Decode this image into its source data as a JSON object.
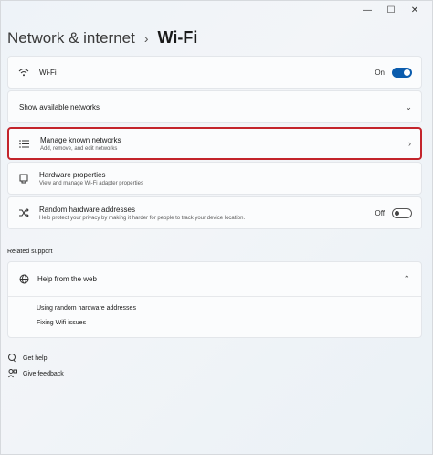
{
  "window": {
    "minimize": "—",
    "maximize": "☐",
    "close": "✕"
  },
  "breadcrumb": {
    "parent": "Network & internet",
    "separator": "›",
    "current": "Wi-Fi"
  },
  "cards": {
    "wifi": {
      "title": "Wi-Fi",
      "state": "On",
      "toggle_on": true
    },
    "available": {
      "title": "Show available networks"
    },
    "known": {
      "title": "Manage known networks",
      "subtitle": "Add, remove, and edit networks"
    },
    "hardware": {
      "title": "Hardware properties",
      "subtitle": "View and manage Wi-Fi adapter properties"
    },
    "random": {
      "title": "Random hardware addresses",
      "subtitle": "Help protect your privacy by making it harder for people to track your device location.",
      "state": "Off",
      "toggle_on": false
    }
  },
  "related": {
    "label": "Related support",
    "help_title": "Help from the web",
    "links": [
      "Using random hardware addresses",
      "Fixing Wifi issues"
    ]
  },
  "footer": {
    "get_help": "Get help",
    "feedback": "Give feedback"
  },
  "colors": {
    "accent": "#0b5cad",
    "highlight": "#c3242b"
  }
}
